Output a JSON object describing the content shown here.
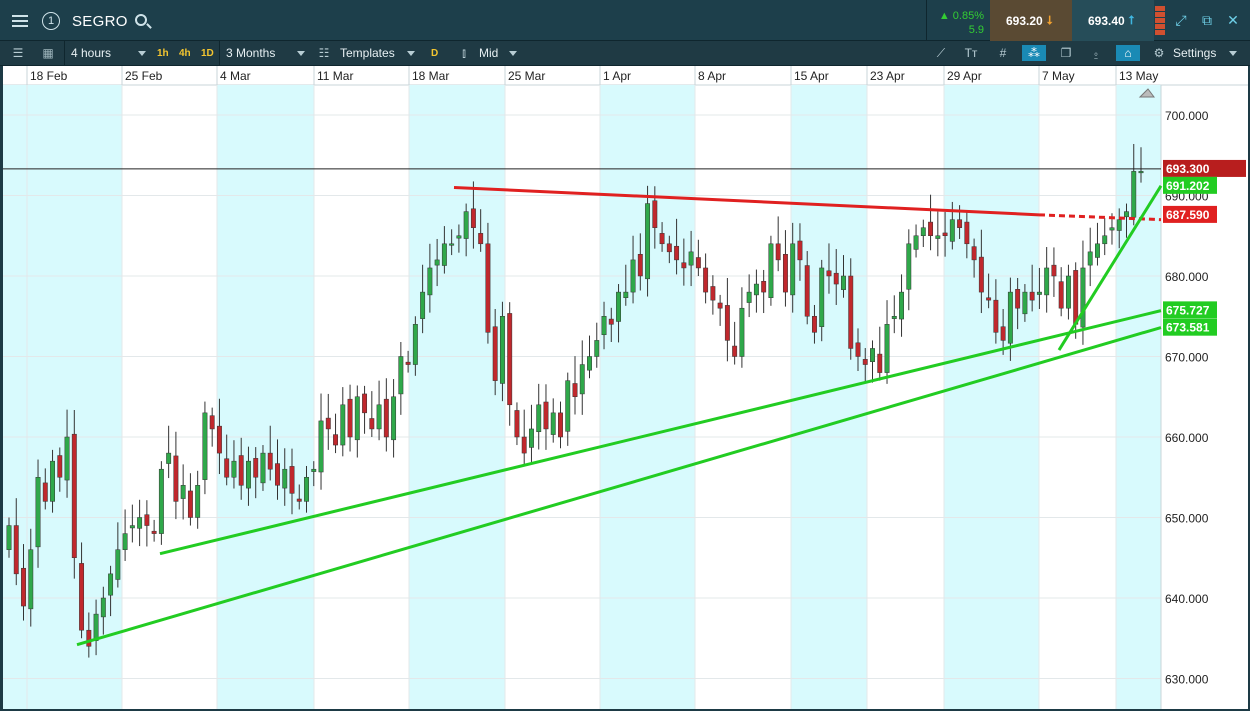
{
  "topbar": {
    "symbol": "SEGRO",
    "change_pct": "0.85%",
    "change_abs": "5.9",
    "sell_price": "693.20",
    "buy_price": "693.40",
    "up_arrow": "▲"
  },
  "toolbar": {
    "interval": "4 hours",
    "tf_1h": "1h",
    "tf_4h": "4h",
    "tf_1d": "1D",
    "range": "3 Months",
    "templates": "Templates",
    "d": "D",
    "mid": "Mid",
    "settings": "Settings"
  },
  "icons": [
    "menu-icon",
    "circle-one-icon",
    "search-icon",
    "sell-arrow-icon",
    "buy-arrow-icon",
    "expand-icon",
    "popout-icon",
    "close-icon",
    "list-icon",
    "layout-icon",
    "candles-icon",
    "draw-line-icon",
    "text-icon",
    "grid-icon",
    "crosshair-icon",
    "layers-icon",
    "alert-icon",
    "tag-icon",
    "gear-icon"
  ],
  "colors": {
    "up": "#2fa84a",
    "down": "#c0282d",
    "resistance": "#e02020",
    "support": "#22cc22",
    "shade": "#d8fafd"
  },
  "chart_data": {
    "type": "candlestick",
    "x_labels": [
      "18 Feb",
      "25 Feb",
      "4 Mar",
      "11 Mar",
      "18 Mar",
      "25 Mar",
      "1 Apr",
      "8 Apr",
      "15 Apr",
      "23 Apr",
      "29 Apr",
      "7 May",
      "13 May"
    ],
    "y_ticks": [
      "700.000",
      "690.000",
      "680.000",
      "670.000",
      "660.000",
      "650.000",
      "640.000",
      "630.000"
    ],
    "ylim": [
      627.5,
      703.5
    ],
    "current_price_label": "693.300",
    "current_price": 693.3,
    "line_labels": [
      {
        "text": "691.202",
        "value": 691.2,
        "kind": "support"
      },
      {
        "text": "687.590",
        "value": 687.59,
        "kind": "resistance"
      },
      {
        "text": "675.727",
        "value": 675.73,
        "kind": "support"
      },
      {
        "text": "673.581",
        "value": 673.58,
        "kind": "support"
      }
    ],
    "closes": [
      649,
      643,
      639,
      646,
      655,
      652,
      657,
      655,
      660,
      645,
      636,
      634,
      638,
      640,
      643,
      646,
      648,
      649,
      650,
      649,
      648,
      656,
      658,
      652,
      654,
      650,
      654,
      663,
      661,
      658,
      655,
      657,
      654,
      657,
      655,
      658,
      656,
      654,
      656,
      653,
      652,
      655,
      656,
      662,
      661,
      659,
      664,
      660,
      665,
      663,
      661,
      664,
      660,
      665,
      670,
      669,
      674,
      678,
      681,
      682,
      684,
      684,
      685,
      688,
      686,
      684,
      673,
      667,
      675,
      664,
      660,
      658,
      661,
      664,
      661,
      663,
      660,
      667,
      665,
      669,
      670,
      672,
      675,
      674,
      678,
      678,
      682,
      680,
      689,
      686,
      684,
      683,
      682,
      681,
      683,
      681,
      678,
      677,
      676,
      672,
      670,
      676,
      678,
      679,
      678,
      684,
      682,
      678,
      684,
      682,
      675,
      673,
      681,
      680,
      679,
      680,
      671,
      670,
      669,
      671,
      668,
      674,
      675,
      678,
      684,
      685,
      686,
      685,
      685,
      685,
      687,
      686,
      684,
      682,
      678,
      677,
      673,
      672,
      678,
      676,
      678,
      677,
      678,
      681,
      680,
      676,
      680,
      674,
      681,
      683,
      684,
      685,
      686,
      687,
      688,
      693,
      693
    ]
  },
  "series_name": "SEGRO"
}
